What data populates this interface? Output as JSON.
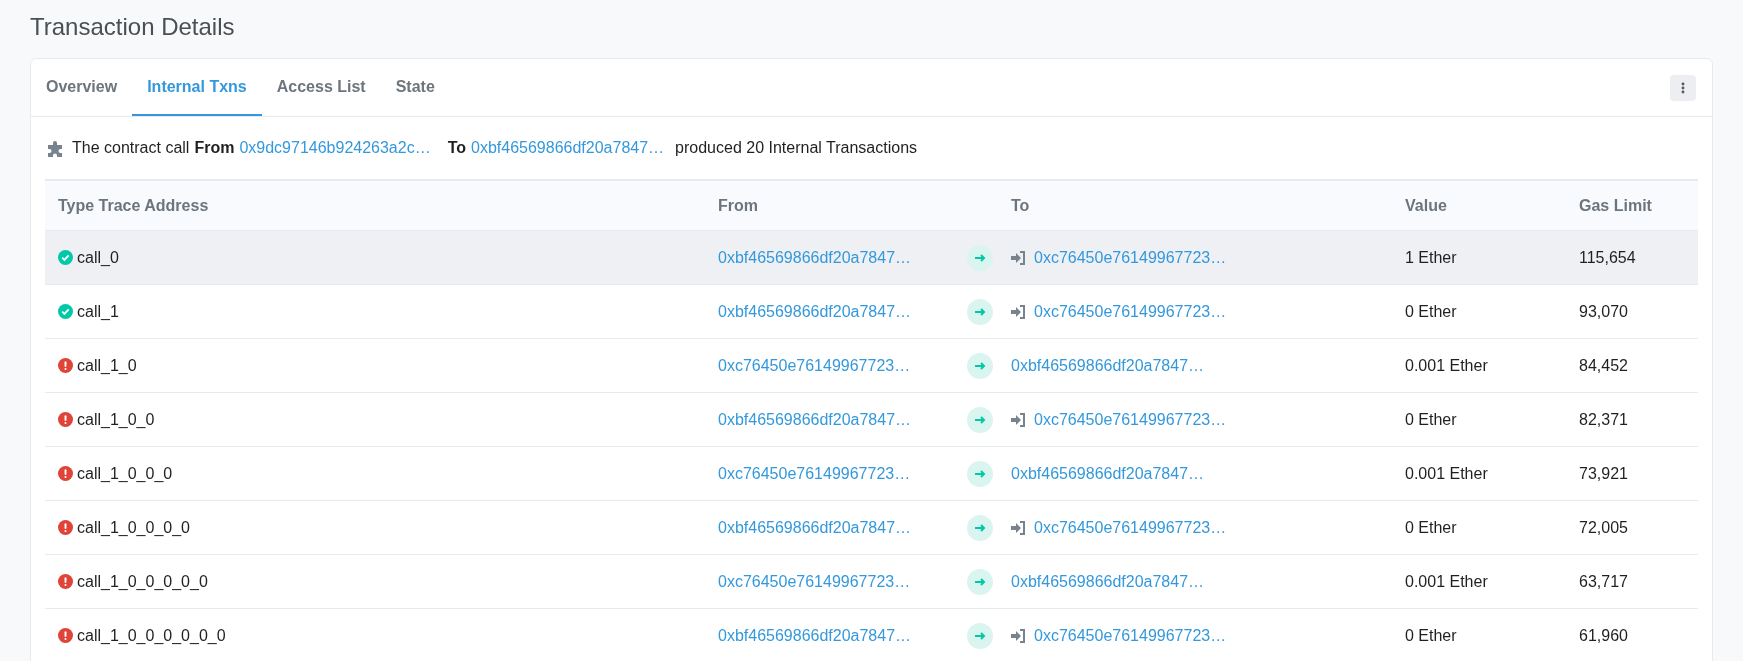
{
  "title": "Transaction Details",
  "tabs": [
    {
      "label": "Overview",
      "selected": false
    },
    {
      "label": "Internal Txns",
      "selected": true
    },
    {
      "label": "Access List",
      "selected": false
    },
    {
      "label": "State",
      "selected": false
    }
  ],
  "summary": {
    "prefix": "The contract call",
    "from_label": "From",
    "from": "0x9dc97146b924263a2c…",
    "to_label": "To",
    "to": "0xbf46569866df20a7847…",
    "suffix": "produced 20 Internal Transactions"
  },
  "table": {
    "columns": [
      "Type Trace Address",
      "From",
      "To",
      "Value",
      "Gas Limit"
    ],
    "rows": [
      {
        "kind": "success",
        "highlighted": true,
        "trace": "call_0",
        "from": "0xbf46569866df20a7847…",
        "to": {
          "kind": "contract",
          "address": "0xc76450e76149967723…"
        },
        "value": "1 Ether",
        "gas_limit": "115,654"
      },
      {
        "kind": "success",
        "highlighted": false,
        "trace": "call_1",
        "from": "0xbf46569866df20a7847…",
        "to": {
          "kind": "contract",
          "address": "0xc76450e76149967723…"
        },
        "value": "0 Ether",
        "gas_limit": "93,070"
      },
      {
        "kind": "error",
        "highlighted": false,
        "trace": "call_1_0",
        "from": "0xc76450e76149967723…",
        "to": {
          "kind": "address",
          "address": "0xbf46569866df20a7847…"
        },
        "value": "0.001 Ether",
        "gas_limit": "84,452"
      },
      {
        "kind": "error",
        "highlighted": false,
        "trace": "call_1_0_0",
        "from": "0xbf46569866df20a7847…",
        "to": {
          "kind": "contract",
          "address": "0xc76450e76149967723…"
        },
        "value": "0 Ether",
        "gas_limit": "82,371"
      },
      {
        "kind": "error",
        "highlighted": false,
        "trace": "call_1_0_0_0",
        "from": "0xc76450e76149967723…",
        "to": {
          "kind": "address",
          "address": "0xbf46569866df20a7847…"
        },
        "value": "0.001 Ether",
        "gas_limit": "73,921"
      },
      {
        "kind": "error",
        "highlighted": false,
        "trace": "call_1_0_0_0_0",
        "from": "0xbf46569866df20a7847…",
        "to": {
          "kind": "contract",
          "address": "0xc76450e76149967723…"
        },
        "value": "0 Ether",
        "gas_limit": "72,005"
      },
      {
        "kind": "error",
        "highlighted": false,
        "trace": "call_1_0_0_0_0_0",
        "from": "0xc76450e76149967723…",
        "to": {
          "kind": "address",
          "address": "0xbf46569866df20a7847…"
        },
        "value": "0.001 Ether",
        "gas_limit": "63,717"
      },
      {
        "kind": "error",
        "highlighted": false,
        "trace": "call_1_0_0_0_0_0_0",
        "from": "0xbf46569866df20a7847…",
        "to": {
          "kind": "contract",
          "address": "0xc76450e76149967723…"
        },
        "value": "0 Ether",
        "gas_limit": "61,960"
      }
    ]
  }
}
